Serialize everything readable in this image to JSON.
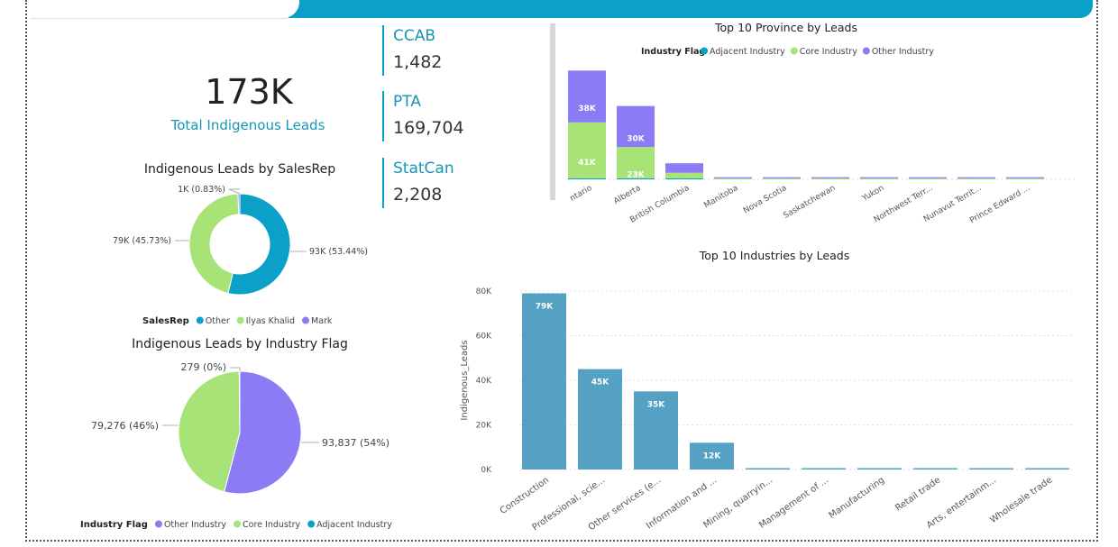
{
  "kpi": {
    "total_value": "173K",
    "total_label": "Total Indigenous Leads"
  },
  "cards": [
    {
      "label": "CCAB",
      "value": "1,482"
    },
    {
      "label": "PTA",
      "value": "169,704"
    },
    {
      "label": "StatCan",
      "value": "2,208"
    }
  ],
  "colors": {
    "accent": "#0aa0c8",
    "adjacent": "#0aa0c8",
    "core": "#a8e377",
    "other": "#8b7cf6",
    "industry_bar": "#55a1c4"
  },
  "chart_data": [
    {
      "type": "donut",
      "title": "Indigenous Leads by SalesRep",
      "legend_title": "SalesRep",
      "slices": [
        {
          "name": "Other",
          "value": 93,
          "label": "93K (53.44%)",
          "color": "#0aa0c8"
        },
        {
          "name": "Ilyas Khalid",
          "value": 79,
          "label": "79K (45.73%)",
          "color": "#a8e377"
        },
        {
          "name": "Mark",
          "value": 1,
          "label": "1K (0.83%)",
          "color": "#8b7cf6"
        }
      ]
    },
    {
      "type": "pie",
      "title": "Indigenous Leads by Industry Flag",
      "legend_title": "Industry Flag",
      "slices": [
        {
          "name": "Other Industry",
          "value": 93837,
          "label": "93,837 (54%)",
          "color": "#8b7cf6"
        },
        {
          "name": "Core Industry",
          "value": 79276,
          "label": "79,276 (46%)",
          "color": "#a8e377"
        },
        {
          "name": "Adjacent Industry",
          "value": 279,
          "label": "279 (0%)",
          "color": "#0aa0c8"
        }
      ]
    },
    {
      "type": "bar",
      "stacked": true,
      "title": "Top 10 Province by Leads",
      "legend_title": "Industry Flag",
      "categories": [
        "Ontario",
        "Alberta",
        "British Columbia",
        "Manitoba",
        "Nova Scotia",
        "Saskatchewan",
        "Yukon",
        "Northwest Terr...",
        "Nunavut Territ...",
        "Prince Edward ..."
      ],
      "category_labels": [
        "ntario",
        "Alberta",
        "British Columbia",
        "Manitoba",
        "Nova Scotia",
        "Saskatchewan",
        "Yukon",
        "Northwest Terr...",
        "Nunavut Territ...",
        "Prince Edward ..."
      ],
      "series": [
        {
          "name": "Adjacent Industry",
          "color": "#0aa0c8",
          "values": [
            0.1,
            0.05,
            0.05,
            0,
            0,
            0,
            0,
            0,
            0,
            0
          ]
        },
        {
          "name": "Core Industry",
          "color": "#a8e377",
          "values": [
            41,
            23,
            4,
            0.8,
            0.6,
            0.5,
            0.3,
            0.2,
            0.1,
            0.05
          ],
          "labels": [
            "41K",
            "23K",
            "",
            "",
            "",
            "",
            "",
            "",
            "",
            ""
          ]
        },
        {
          "name": "Other Industry",
          "color": "#8b7cf6",
          "values": [
            38,
            30,
            7,
            0.7,
            0.6,
            0.5,
            0.3,
            0.2,
            0.1,
            0.05
          ],
          "labels": [
            "38K",
            "30K",
            "",
            "",
            "",
            "",
            "",
            "",
            "",
            ""
          ]
        }
      ],
      "ylim": [
        0,
        80
      ]
    },
    {
      "type": "bar",
      "title": "Top 10 Industries by Leads",
      "ylabel": "Indigenous_Leads",
      "categories": [
        "Construction",
        "Professional, scie...",
        "Other services (e...",
        "Information and ...",
        "Mining, quarryin...",
        "Management of ...",
        "Manufacturing",
        "Retail trade",
        "Arts, entertainm...",
        "Wholesale trade"
      ],
      "values": [
        79,
        45,
        35,
        12,
        0.5,
        0.4,
        0.3,
        0.3,
        0.2,
        0.2
      ],
      "value_labels": [
        "79K",
        "45K",
        "35K",
        "12K",
        "",
        "",
        "",
        "",
        "",
        ""
      ],
      "yticks": [
        0,
        20,
        40,
        60,
        80
      ],
      "ytick_labels": [
        "0K",
        "20K",
        "40K",
        "60K",
        "80K"
      ],
      "ylim": [
        0,
        80
      ]
    }
  ]
}
